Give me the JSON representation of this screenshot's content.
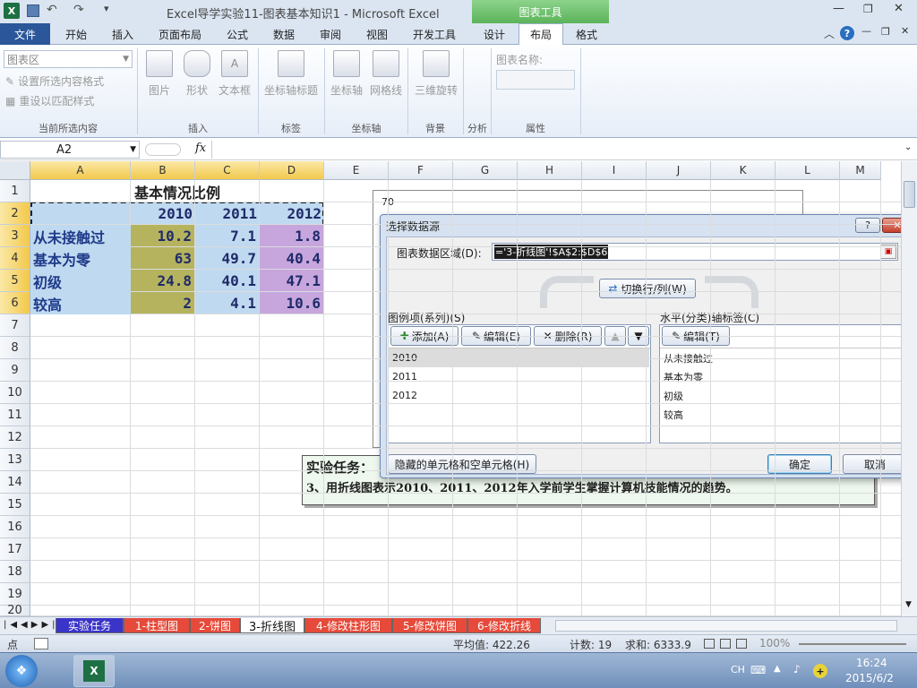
{
  "window": {
    "title": "Excel导学实验11-图表基本知识1  -  Microsoft Excel",
    "chart_tools_label": "图表工具"
  },
  "ribbon_tabs": [
    "文件",
    "开始",
    "插入",
    "页面布局",
    "公式",
    "数据",
    "审阅",
    "视图",
    "开发工具",
    "设计",
    "布局",
    "格式"
  ],
  "ribbon": {
    "chart_area_dropdown": "图表区",
    "format_selection": "设置所选内容格式",
    "reset_style": "重设以匹配样式",
    "current_selection_group": "当前所选内容",
    "insert_group": "插入",
    "picture": "图片",
    "shapes": "形状",
    "textbox": "文本框",
    "axis_title": "坐标轴标题",
    "labels_group": "标签",
    "axis": "坐标轴",
    "gridlines": "网格线",
    "axes_group": "坐标轴",
    "rotation_3d": "三维旋转",
    "background_group": "背景",
    "analysis_group": "分析",
    "chart_name_label": "图表名称:",
    "properties_group": "属性"
  },
  "formula_bar": {
    "name_box": "A2",
    "fx": "fx",
    "formula": ""
  },
  "columns": [
    "A",
    "B",
    "C",
    "D",
    "E",
    "F",
    "G",
    "H",
    "I",
    "J",
    "K",
    "L",
    "M"
  ],
  "rows": [
    "1",
    "2",
    "3",
    "4",
    "5",
    "6",
    "7",
    "8",
    "9",
    "10",
    "11",
    "12",
    "13",
    "14",
    "15",
    "16",
    "17",
    "18",
    "19",
    "20"
  ],
  "sheet": {
    "title": "基本情况比例",
    "years": [
      "2010",
      "2011",
      "2012"
    ],
    "data": [
      {
        "label": "从未接触过",
        "v": [
          "10.2",
          "7.1",
          "1.8"
        ]
      },
      {
        "label": "基本为零",
        "v": [
          "63",
          "49.7",
          "40.4"
        ]
      },
      {
        "label": "初级",
        "v": [
          "24.8",
          "40.1",
          "47.1"
        ]
      },
      {
        "label": "较高",
        "v": [
          "2",
          "4.1",
          "10.6"
        ]
      }
    ],
    "chart_axis_top": "70",
    "task_title": "实验任务：",
    "task_text": "3、用折线图表示2010、2011、2012年入学前学生掌握计算机技能情况的趋势。"
  },
  "dialog": {
    "title": "选择数据源",
    "help": "?",
    "close": "✕",
    "range_label": "图表数据区域(D):",
    "range_value": "='3-折线图'!$A$2:$D$6",
    "switch_button": "切换行/列(W)",
    "legend_label": "图例项(系列)(S)",
    "add": "添加(A)",
    "edit": "编辑(E)",
    "remove": "删除(R)",
    "series": [
      "2010",
      "2011",
      "2012"
    ],
    "axis_label": "水平(分类)轴标签(C)",
    "axis_edit": "编辑(T)",
    "categories": [
      "从未接触过",
      "基本为零",
      "初级",
      "较高"
    ],
    "hidden_cells": "隐藏的单元格和空单元格(H)",
    "ok": "确定",
    "cancel": "取消"
  },
  "sheet_tabs": [
    "实验任务",
    "1-柱型图",
    "2-饼图",
    "3-折线图",
    "4-修改柱形图",
    "5-修改饼图",
    "6-修改折线"
  ],
  "status": {
    "mode": "点",
    "avg": "平均值: 422.26",
    "count": "计数: 19",
    "sum": "求和: 6333.9",
    "zoom": "100%"
  },
  "taskbar": {
    "lang": "CH",
    "time": "16:24",
    "date": "2015/6/2"
  },
  "colors": {
    "olive": "#b5b35e",
    "lightblue": "#bfd9f0",
    "purple": "#c7a6dd",
    "accent": "#2b579a"
  }
}
